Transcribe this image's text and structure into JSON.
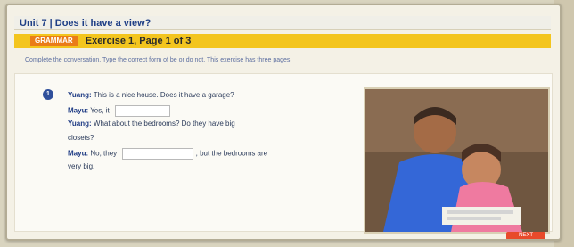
{
  "window": {
    "title": "Unit 7 | Does it have a view?"
  },
  "exercise": {
    "badge": "GRAMMAR",
    "title": "Exercise 1, Page 1 of 3"
  },
  "instructions": "Complete the conversation. Type the correct form of be or do not. This exercise has three pages.",
  "question": {
    "number": "1",
    "lines": [
      {
        "speaker": "Yuang:",
        "text": "This is a nice house. Does it have a garage?"
      },
      {
        "speaker": "Mayu:",
        "text": "Yes, it",
        "has_blank": true
      },
      {
        "speaker": "Yuang:",
        "text": "What about the bedrooms? Do they have big"
      },
      {
        "speaker": "",
        "text": "closets?"
      },
      {
        "speaker": "Mayu:",
        "text": "No, they",
        "has_blank": true,
        "after_blank": ", but the bedrooms are"
      },
      {
        "speaker": "",
        "text": "very big."
      }
    ]
  },
  "next_button": "NEXT"
}
